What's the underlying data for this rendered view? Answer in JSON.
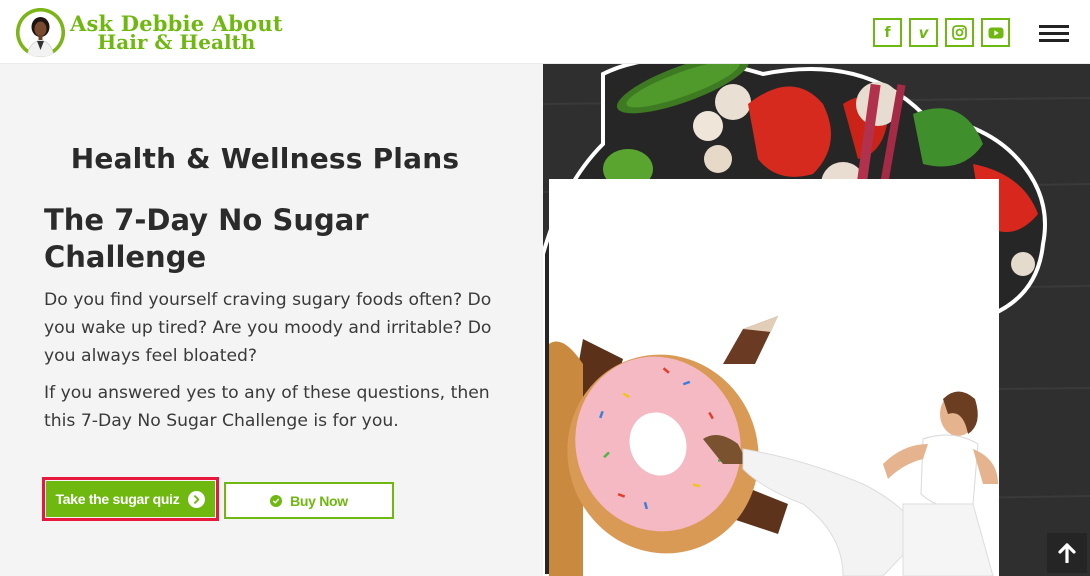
{
  "header": {
    "logo_line1": "Ask Debbie About",
    "logo_line2": "Hair & Health",
    "brand_color": "#6fb80f",
    "socials": [
      {
        "name": "facebook",
        "glyph": "f"
      },
      {
        "name": "vimeo",
        "glyph": "v"
      },
      {
        "name": "instagram",
        "glyph": ""
      },
      {
        "name": "youtube",
        "glyph": ""
      }
    ],
    "menu_icon": "hamburger-menu-icon"
  },
  "main": {
    "section_title": "Health & Wellness Plans",
    "plan_title": "The 7-Day No Sugar Challenge",
    "paragraph1": "Do you find yourself craving sugary foods often? Do you wake up tired? Are you moody and irritable? Do you always feel bloated?",
    "paragraph2": "If you answered yes to any of these questions, then this 7-Day No Sugar Challenge is for you.",
    "quiz_button": "Take the sugar quiz",
    "buy_button": "Buy Now"
  },
  "colors": {
    "accent": "#6fb80f",
    "highlight": "#e8173c",
    "text": "#2b2b2b"
  },
  "scroll_top_icon": "arrow-up-icon"
}
